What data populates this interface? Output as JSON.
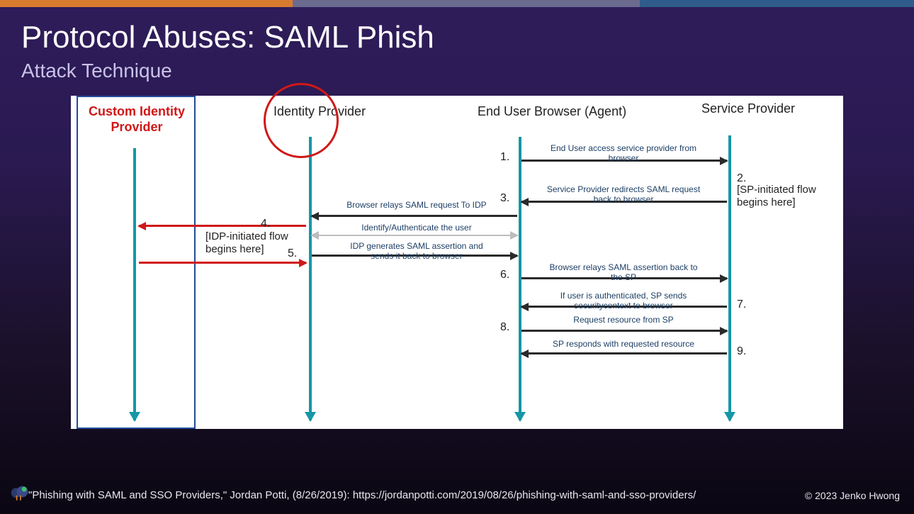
{
  "slide": {
    "title": "Protocol Abuses: SAML Phish",
    "subtitle": "Attack Technique"
  },
  "actors": {
    "custom_idp": "Custom Identity Provider",
    "idp": "Identity Provider",
    "browser": "End User Browser (Agent)",
    "sp": "Service Provider"
  },
  "steps": {
    "s1": "1.",
    "s2": "2.",
    "s3": "3.",
    "s4": "4.",
    "s5": "5.",
    "s6": "6.",
    "s7": "7.",
    "s8": "8.",
    "s9": "9."
  },
  "notes": {
    "sp_initiated": "[SP-initiated flow begins here]",
    "idp_initiated": "[IDP-initiated flow begins here]"
  },
  "messages": {
    "m1": "End User access service provider from browser",
    "m2": "Service Provider redirects SAML request back to browser",
    "m3": "Browser relays SAML request To IDP",
    "m4": "Identify/Authenticate the user",
    "m5": "IDP generates SAML assertion and sends it back to browser",
    "m6": "Browser relays SAML assertion back to the SP",
    "m7": "If user is authenticated, SP sends securitycontext to browser",
    "m8": "Request resource from SP",
    "m9": "SP responds with requested resource"
  },
  "footer": {
    "citation": "\"Phishing with SAML and SSO Providers,\" Jordan Potti, (8/26/2019): https://jordanpotti.com/2019/08/26/phishing-with-saml-and-sso-providers/",
    "copyright": "© 2023 Jenko Hwong"
  }
}
